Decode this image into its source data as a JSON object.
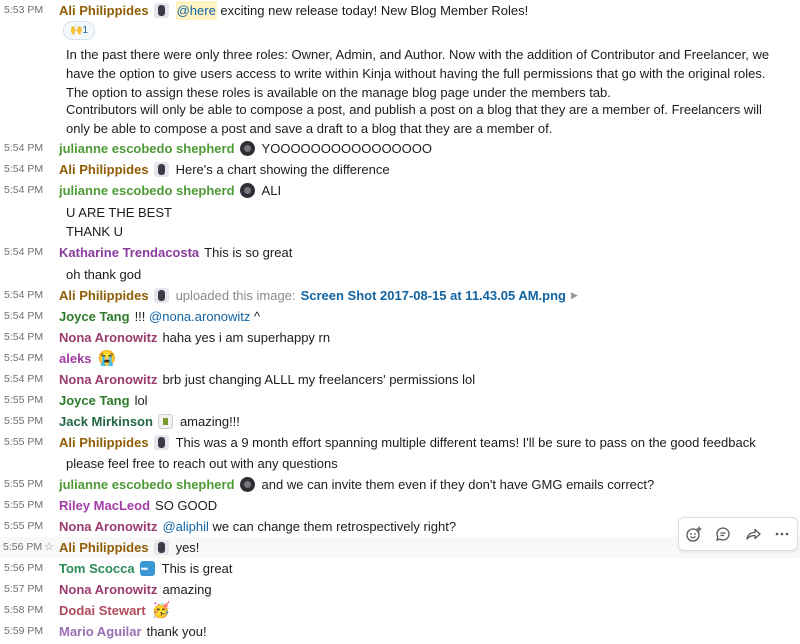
{
  "colors": {
    "ali": "#8f5d05",
    "julianne": "#4e9a35",
    "katharine": "#8a3c9c",
    "joyce": "#2c7b2c",
    "nona": "#9b3b6e",
    "aleks": "#a23ca0",
    "jack": "#226644",
    "riley": "#a33ca6",
    "tom": "#2c8c5a",
    "dodai": "#b04a5a",
    "mario": "#9a6fb3",
    "link": "#1264a3",
    "timestamp": "#707070",
    "mention_bg": "#fff3c4"
  },
  "messages": [
    {
      "time": "5:53 PM",
      "author": "Ali Philippides",
      "avatar": "ali-avatar",
      "mention": "@here",
      "text": "exciting new release today! New Blog Member Roles!",
      "reaction": {
        "emoji": "🙌",
        "count": "1"
      },
      "paragraphs": [
        "In the past there were only three roles: Owner, Admin, and Author. Now with the addition of Contributor and Freelancer, we have the option to give users access to write within Kinja without having the full permissions that go with the original roles. The option to assign these roles is available on the manage blog page under the members tab.",
        "Contributors will only be able to compose a post, and publish a post on a blog that they are a member of. Freelancers will only be able to compose a post and save a draft to a blog that they are a member of."
      ]
    },
    {
      "time": "5:54 PM",
      "author": "julianne escobedo shepherd",
      "text": "YOOOOOOOOOOOOOOOO"
    },
    {
      "time": "5:54 PM",
      "author": "Ali Philippides",
      "text": "Here's a chart showing the difference"
    },
    {
      "time": "5:54 PM",
      "author": "julianne escobedo shepherd",
      "text": "ALI",
      "continuations": [
        "U ARE THE BEST",
        "THANK U"
      ]
    },
    {
      "time": "5:54 PM",
      "author": "Katharine Trendacosta",
      "text": "This is so great",
      "continuations": [
        "oh thank god"
      ]
    },
    {
      "time": "5:54 PM",
      "author": "Ali Philippides",
      "action": "uploaded this image:",
      "file": "Screen Shot 2017-08-15 at 11.43.05 AM.png"
    },
    {
      "time": "5:54 PM",
      "author": "Joyce Tang",
      "prefix": "!!!",
      "mention": "@nona.aronowitz",
      "text": "^"
    },
    {
      "time": "5:54 PM",
      "author": "Nona Aronowitz",
      "text": "haha yes i am superhappy rn"
    },
    {
      "time": "5:54 PM",
      "author": "aleks",
      "emoji": "😭"
    },
    {
      "time": "5:54 PM",
      "author": "Nona Aronowitz",
      "text": "brb just changing ALLL my freelancers' permissions lol"
    },
    {
      "time": "5:55 PM",
      "author": "Joyce Tang",
      "text": "lol"
    },
    {
      "time": "5:55 PM",
      "author": "Jack Mirkinson",
      "text": "amazing!!!"
    },
    {
      "time": "5:55 PM",
      "author": "Ali Philippides",
      "text": "This was a 9 month effort spanning multiple different teams! I'll be sure to pass on the good feedback",
      "continuations": [
        "please feel free to reach out with any questions"
      ]
    },
    {
      "time": "5:55 PM",
      "author": "julianne escobedo shepherd",
      "text": "and we can invite them even if they don't have GMG emails correct?"
    },
    {
      "time": "5:55 PM",
      "author": "Riley MacLeod",
      "text": "SO GOOD"
    },
    {
      "time": "5:55 PM",
      "author": "Nona Aronowitz",
      "mention": "@aliphil",
      "text": "we can change them retrospectively right?"
    },
    {
      "time": "5:56 PM",
      "author": "Ali Philippides",
      "text": "yes!"
    },
    {
      "time": "5:56 PM",
      "author": "Tom Scocca",
      "text": "This is great"
    },
    {
      "time": "5:57 PM",
      "author": "Nona Aronowitz",
      "text": "amazing"
    },
    {
      "time": "5:58 PM",
      "author": "Dodai Stewart",
      "emoji": "🥳"
    },
    {
      "time": "5:59 PM",
      "author": "Mario Aguilar",
      "text": "thank you!"
    }
  ],
  "hover_toolbar": {
    "icons": [
      "add-reaction-icon",
      "start-thread-icon",
      "share-message-icon",
      "more-actions-icon"
    ]
  }
}
